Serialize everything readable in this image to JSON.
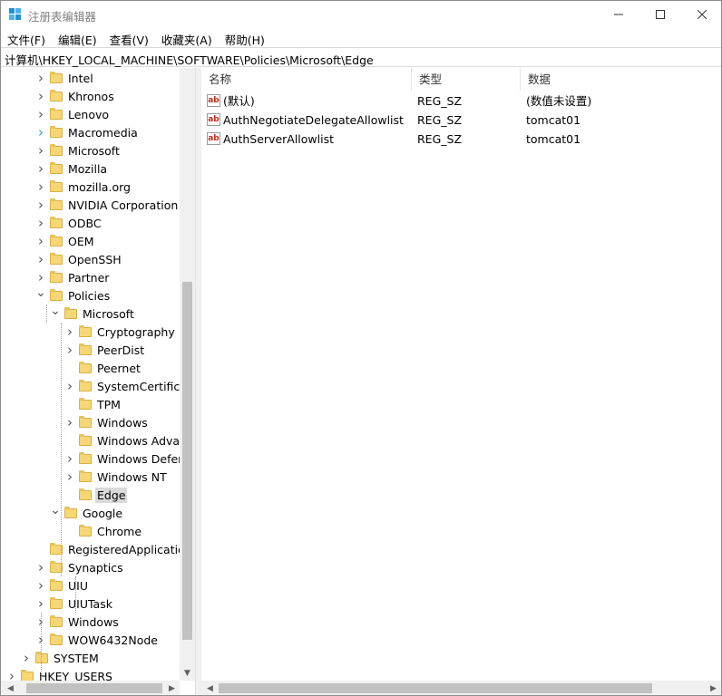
{
  "window": {
    "title": "注册表编辑器"
  },
  "menu": [
    "文件(F)",
    "编辑(E)",
    "查看(V)",
    "收藏夹(A)",
    "帮助(H)"
  ],
  "address": "计算机\\HKEY_LOCAL_MACHINE\\SOFTWARE\\Policies\\Microsoft\\Edge",
  "tree": [
    {
      "label": "Intel",
      "level": 2,
      "expander": "collapsed"
    },
    {
      "label": "Khronos",
      "level": 2,
      "expander": "collapsed"
    },
    {
      "label": "Lenovo",
      "level": 2,
      "expander": "collapsed"
    },
    {
      "label": "Macromedia",
      "level": 2,
      "expander": "collapsed-hover"
    },
    {
      "label": "Microsoft",
      "level": 2,
      "expander": "collapsed"
    },
    {
      "label": "Mozilla",
      "level": 2,
      "expander": "collapsed"
    },
    {
      "label": "mozilla.org",
      "level": 2,
      "expander": "collapsed"
    },
    {
      "label": "NVIDIA Corporation",
      "level": 2,
      "expander": "collapsed"
    },
    {
      "label": "ODBC",
      "level": 2,
      "expander": "collapsed"
    },
    {
      "label": "OEM",
      "level": 2,
      "expander": "collapsed"
    },
    {
      "label": "OpenSSH",
      "level": 2,
      "expander": "collapsed"
    },
    {
      "label": "Partner",
      "level": 2,
      "expander": "collapsed"
    },
    {
      "label": "Policies",
      "level": 2,
      "expander": "expanded"
    },
    {
      "label": "Microsoft",
      "level": 3,
      "expander": "expanded"
    },
    {
      "label": "Cryptography",
      "level": 4,
      "expander": "collapsed"
    },
    {
      "label": "PeerDist",
      "level": 4,
      "expander": "collapsed"
    },
    {
      "label": "Peernet",
      "level": 4,
      "expander": "none"
    },
    {
      "label": "SystemCertificat",
      "level": 4,
      "expander": "collapsed"
    },
    {
      "label": "TPM",
      "level": 4,
      "expander": "none"
    },
    {
      "label": "Windows",
      "level": 4,
      "expander": "collapsed"
    },
    {
      "label": "Windows Advan",
      "level": 4,
      "expander": "none"
    },
    {
      "label": "Windows Defen",
      "level": 4,
      "expander": "collapsed"
    },
    {
      "label": "Windows NT",
      "level": 4,
      "expander": "collapsed"
    },
    {
      "label": "Edge",
      "level": 4,
      "expander": "none",
      "selected": true
    },
    {
      "label": "Google",
      "level": 3,
      "expander": "expanded"
    },
    {
      "label": "Chrome",
      "level": 4,
      "expander": "none"
    },
    {
      "label": "RegisteredApplication",
      "level": 2,
      "expander": "none"
    },
    {
      "label": "Synaptics",
      "level": 2,
      "expander": "collapsed"
    },
    {
      "label": "UIU",
      "level": 2,
      "expander": "collapsed"
    },
    {
      "label": "UIUTask",
      "level": 2,
      "expander": "collapsed"
    },
    {
      "label": "Windows",
      "level": 2,
      "expander": "collapsed"
    },
    {
      "label": "WOW6432Node",
      "level": 2,
      "expander": "collapsed"
    },
    {
      "label": "SYSTEM",
      "level": 1,
      "expander": "collapsed"
    },
    {
      "label": "HKEY_USERS",
      "level": 0,
      "expander": "collapsed"
    }
  ],
  "list": {
    "columns": [
      "名称",
      "类型",
      "数据"
    ],
    "rows": [
      {
        "name": "(默认)",
        "type": "REG_SZ",
        "data": "(数值未设置)",
        "icon": "string-value-icon"
      },
      {
        "name": "AuthNegotiateDelegateAllowlist",
        "type": "REG_SZ",
        "data": "tomcat01",
        "icon": "string-value-icon"
      },
      {
        "name": "AuthServerAllowlist",
        "type": "REG_SZ",
        "data": "tomcat01",
        "icon": "string-value-icon"
      }
    ],
    "icon_text": "ab"
  },
  "colors": {
    "folder": "#f7d775",
    "selected": "#d9d9d9",
    "icon_red": "#c42b1c"
  }
}
